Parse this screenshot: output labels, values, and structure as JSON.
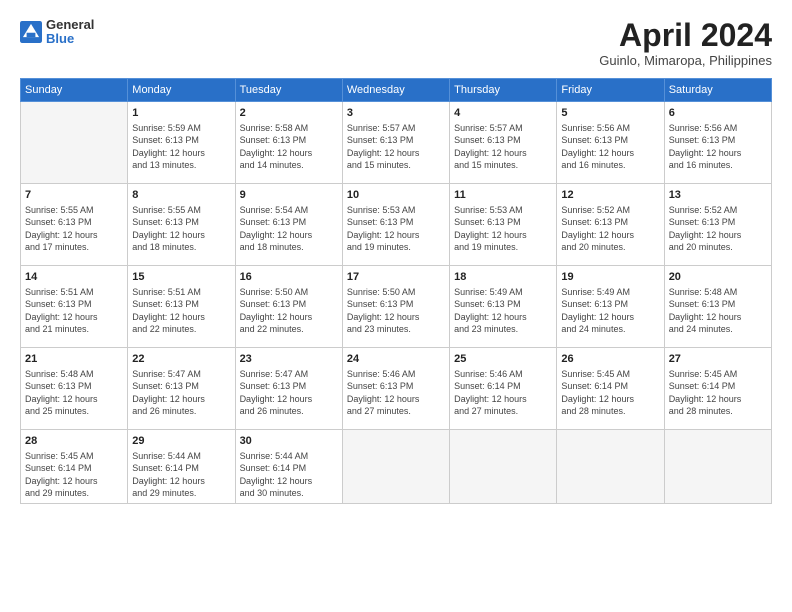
{
  "header": {
    "logo_general": "General",
    "logo_blue": "Blue",
    "title": "April 2024",
    "location": "Guinlo, Mimaropa, Philippines"
  },
  "weekdays": [
    "Sunday",
    "Monday",
    "Tuesday",
    "Wednesday",
    "Thursday",
    "Friday",
    "Saturday"
  ],
  "weeks": [
    [
      {
        "day": "",
        "info": ""
      },
      {
        "day": "1",
        "info": "Sunrise: 5:59 AM\nSunset: 6:13 PM\nDaylight: 12 hours\nand 13 minutes."
      },
      {
        "day": "2",
        "info": "Sunrise: 5:58 AM\nSunset: 6:13 PM\nDaylight: 12 hours\nand 14 minutes."
      },
      {
        "day": "3",
        "info": "Sunrise: 5:57 AM\nSunset: 6:13 PM\nDaylight: 12 hours\nand 15 minutes."
      },
      {
        "day": "4",
        "info": "Sunrise: 5:57 AM\nSunset: 6:13 PM\nDaylight: 12 hours\nand 15 minutes."
      },
      {
        "day": "5",
        "info": "Sunrise: 5:56 AM\nSunset: 6:13 PM\nDaylight: 12 hours\nand 16 minutes."
      },
      {
        "day": "6",
        "info": "Sunrise: 5:56 AM\nSunset: 6:13 PM\nDaylight: 12 hours\nand 16 minutes."
      }
    ],
    [
      {
        "day": "7",
        "info": "Sunrise: 5:55 AM\nSunset: 6:13 PM\nDaylight: 12 hours\nand 17 minutes."
      },
      {
        "day": "8",
        "info": "Sunrise: 5:55 AM\nSunset: 6:13 PM\nDaylight: 12 hours\nand 18 minutes."
      },
      {
        "day": "9",
        "info": "Sunrise: 5:54 AM\nSunset: 6:13 PM\nDaylight: 12 hours\nand 18 minutes."
      },
      {
        "day": "10",
        "info": "Sunrise: 5:53 AM\nSunset: 6:13 PM\nDaylight: 12 hours\nand 19 minutes."
      },
      {
        "day": "11",
        "info": "Sunrise: 5:53 AM\nSunset: 6:13 PM\nDaylight: 12 hours\nand 19 minutes."
      },
      {
        "day": "12",
        "info": "Sunrise: 5:52 AM\nSunset: 6:13 PM\nDaylight: 12 hours\nand 20 minutes."
      },
      {
        "day": "13",
        "info": "Sunrise: 5:52 AM\nSunset: 6:13 PM\nDaylight: 12 hours\nand 20 minutes."
      }
    ],
    [
      {
        "day": "14",
        "info": "Sunrise: 5:51 AM\nSunset: 6:13 PM\nDaylight: 12 hours\nand 21 minutes."
      },
      {
        "day": "15",
        "info": "Sunrise: 5:51 AM\nSunset: 6:13 PM\nDaylight: 12 hours\nand 22 minutes."
      },
      {
        "day": "16",
        "info": "Sunrise: 5:50 AM\nSunset: 6:13 PM\nDaylight: 12 hours\nand 22 minutes."
      },
      {
        "day": "17",
        "info": "Sunrise: 5:50 AM\nSunset: 6:13 PM\nDaylight: 12 hours\nand 23 minutes."
      },
      {
        "day": "18",
        "info": "Sunrise: 5:49 AM\nSunset: 6:13 PM\nDaylight: 12 hours\nand 23 minutes."
      },
      {
        "day": "19",
        "info": "Sunrise: 5:49 AM\nSunset: 6:13 PM\nDaylight: 12 hours\nand 24 minutes."
      },
      {
        "day": "20",
        "info": "Sunrise: 5:48 AM\nSunset: 6:13 PM\nDaylight: 12 hours\nand 24 minutes."
      }
    ],
    [
      {
        "day": "21",
        "info": "Sunrise: 5:48 AM\nSunset: 6:13 PM\nDaylight: 12 hours\nand 25 minutes."
      },
      {
        "day": "22",
        "info": "Sunrise: 5:47 AM\nSunset: 6:13 PM\nDaylight: 12 hours\nand 26 minutes."
      },
      {
        "day": "23",
        "info": "Sunrise: 5:47 AM\nSunset: 6:13 PM\nDaylight: 12 hours\nand 26 minutes."
      },
      {
        "day": "24",
        "info": "Sunrise: 5:46 AM\nSunset: 6:13 PM\nDaylight: 12 hours\nand 27 minutes."
      },
      {
        "day": "25",
        "info": "Sunrise: 5:46 AM\nSunset: 6:14 PM\nDaylight: 12 hours\nand 27 minutes."
      },
      {
        "day": "26",
        "info": "Sunrise: 5:45 AM\nSunset: 6:14 PM\nDaylight: 12 hours\nand 28 minutes."
      },
      {
        "day": "27",
        "info": "Sunrise: 5:45 AM\nSunset: 6:14 PM\nDaylight: 12 hours\nand 28 minutes."
      }
    ],
    [
      {
        "day": "28",
        "info": "Sunrise: 5:45 AM\nSunset: 6:14 PM\nDaylight: 12 hours\nand 29 minutes."
      },
      {
        "day": "29",
        "info": "Sunrise: 5:44 AM\nSunset: 6:14 PM\nDaylight: 12 hours\nand 29 minutes."
      },
      {
        "day": "30",
        "info": "Sunrise: 5:44 AM\nSunset: 6:14 PM\nDaylight: 12 hours\nand 30 minutes."
      },
      {
        "day": "",
        "info": ""
      },
      {
        "day": "",
        "info": ""
      },
      {
        "day": "",
        "info": ""
      },
      {
        "day": "",
        "info": ""
      }
    ]
  ]
}
